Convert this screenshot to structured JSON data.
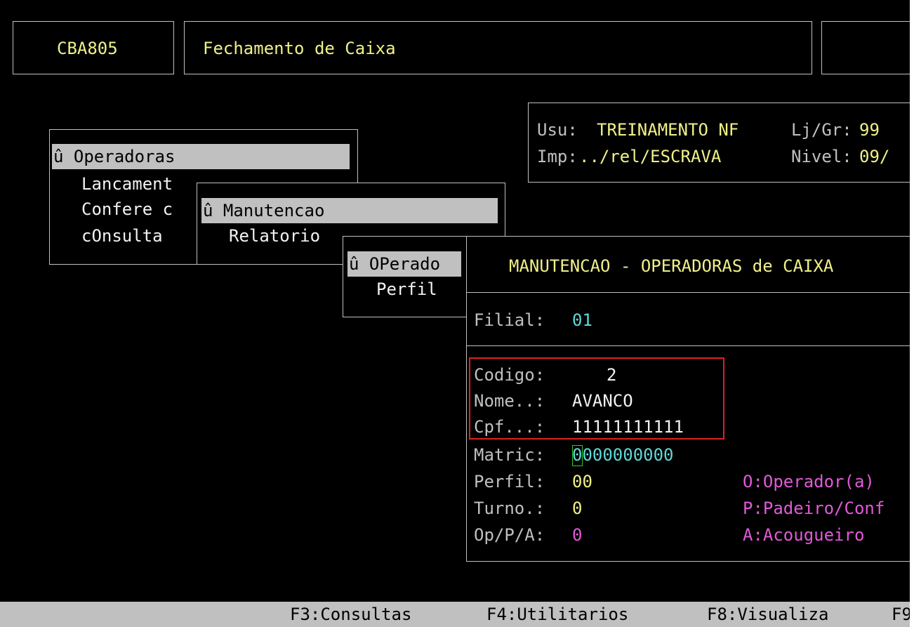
{
  "header": {
    "program_code": "CBA805",
    "screen_title": "Fechamento de Caixa"
  },
  "session": {
    "user_label": "Usu:",
    "user_value": "TREINAMENTO NF",
    "store_label": "Lj/Gr:",
    "store_value": "99",
    "printer_label": "Imp:",
    "printer_value": "../rel/ESCRAVA",
    "level_label": "Nivel:",
    "level_value": "09/"
  },
  "menu1": {
    "selected": "û Operadoras",
    "items": [
      "Lancament",
      "Confere c",
      "cOnsulta"
    ]
  },
  "menu2": {
    "selected": "û Manutencao",
    "items": [
      "Relatorio"
    ]
  },
  "menu3": {
    "selected": "û OPerado",
    "items": [
      "Perfil"
    ]
  },
  "form": {
    "title": "MANUTENCAO - OPERADORAS de CAIXA",
    "filial_label": "Filial:",
    "filial_value": "01",
    "codigo_label": "Codigo:",
    "codigo_value": "2",
    "nome_label": "Nome..:",
    "nome_value": "AVANCO",
    "cpf_label": "Cpf...:",
    "cpf_value": "11111111111",
    "matric_label": "Matric:",
    "matric_value": "0000000000",
    "perfil_label": "Perfil:",
    "perfil_value": "00",
    "turno_label": "Turno.:",
    "turno_value": "0",
    "opa_label": "Op/P/A:",
    "opa_value": "0",
    "legend": [
      "O:Operador(a)",
      "P:Padeiro/Conf",
      "A:Acougueiro"
    ]
  },
  "function_keys": [
    "F3:Consultas",
    "F4:Utilitarios",
    "F8:Visualiza",
    "F9"
  ],
  "colors": {
    "background": "#000000",
    "yellow_text": "#f0f08a",
    "cyan_value": "#5fd7d7",
    "magenta_legend": "#e05ad8",
    "highlight_bar": "#c0c0c0",
    "annotation_box": "#e02020",
    "cursor": "#2ad12a"
  }
}
